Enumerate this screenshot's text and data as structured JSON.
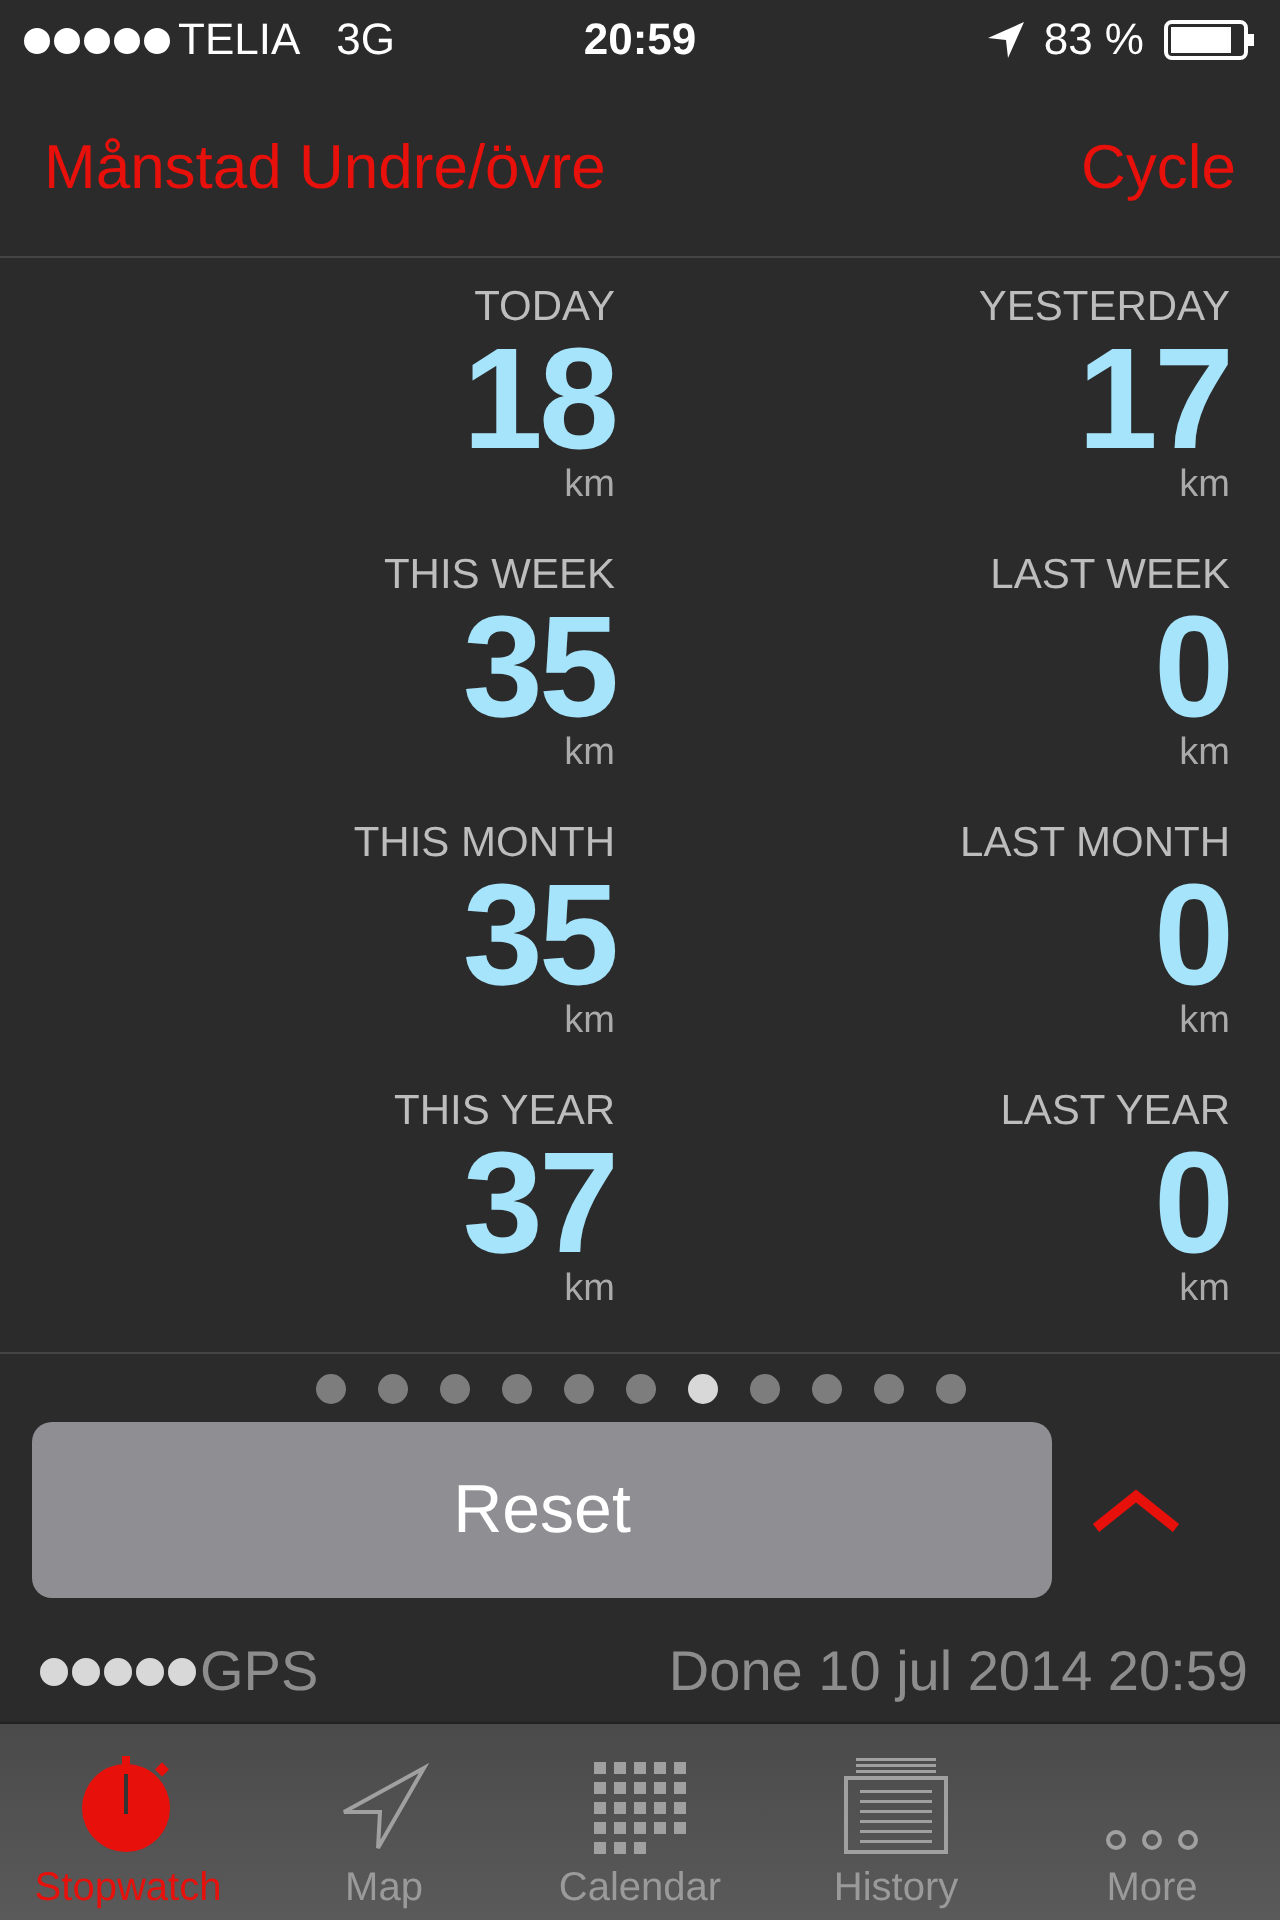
{
  "status_bar": {
    "carrier": "TELIA",
    "network": "3G",
    "time": "20:59",
    "battery": "83 %",
    "signal_dots": [
      {
        "filled": true
      },
      {
        "filled": true
      },
      {
        "filled": true
      },
      {
        "filled": true
      },
      {
        "filled": true
      }
    ]
  },
  "header": {
    "title": "Månstad Undre/övre",
    "activity": "Cycle"
  },
  "stats": [
    {
      "label": "TODAY",
      "value": "18",
      "unit": "km"
    },
    {
      "label": "YESTERDAY",
      "value": "17",
      "unit": "km"
    },
    {
      "label": "THIS WEEK",
      "value": "35",
      "unit": "km"
    },
    {
      "label": "LAST WEEK",
      "value": "0",
      "unit": "km"
    },
    {
      "label": "THIS MONTH",
      "value": "35",
      "unit": "km"
    },
    {
      "label": "LAST MONTH",
      "value": "0",
      "unit": "km"
    },
    {
      "label": "THIS YEAR",
      "value": "37",
      "unit": "km"
    },
    {
      "label": "LAST YEAR",
      "value": "0",
      "unit": "km"
    }
  ],
  "pages": [
    {
      "selected": false
    },
    {
      "selected": false
    },
    {
      "selected": false
    },
    {
      "selected": false
    },
    {
      "selected": false
    },
    {
      "selected": false
    },
    {
      "selected": true
    },
    {
      "selected": false
    },
    {
      "selected": false
    },
    {
      "selected": false
    },
    {
      "selected": false
    }
  ],
  "reset_button": "Reset",
  "gps": {
    "label": "GPS",
    "dots": [
      {
        "filled": true
      },
      {
        "filled": true
      },
      {
        "filled": true
      },
      {
        "filled": true
      },
      {
        "filled": true
      }
    ]
  },
  "done_text": "Done 10 jul 2014 20:59",
  "tabs": [
    {
      "kind": "stopwatch",
      "label": "Stopwatch",
      "selected": true
    },
    {
      "kind": "map",
      "label": "Map",
      "selected": false
    },
    {
      "kind": "calendar",
      "label": "Calendar",
      "selected": false
    },
    {
      "kind": "history",
      "label": "History",
      "selected": false
    },
    {
      "kind": "more",
      "label": "More",
      "selected": false
    }
  ]
}
